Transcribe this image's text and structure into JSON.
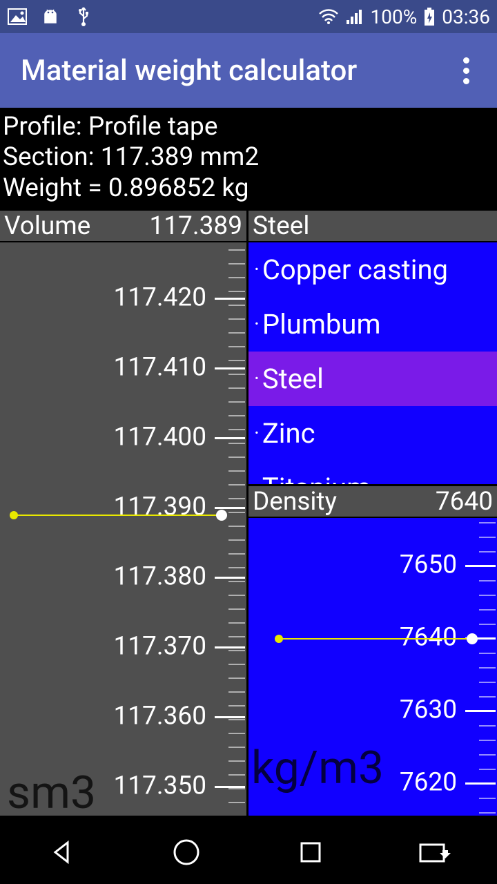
{
  "status": {
    "battery": "100%",
    "time": "03:36"
  },
  "appbar": {
    "title": "Material weight calculator"
  },
  "info": {
    "profile_label": "Profile:",
    "profile_value": "Profile tape",
    "section_label": "Section:",
    "section_value": "117.389 mm2",
    "weight_label": "Weight =",
    "weight_value": "0.896852 kg"
  },
  "volume": {
    "label": "Volume",
    "value": "117.389",
    "unit": "sm3",
    "ticks": [
      "117.420",
      "117.410",
      "117.400",
      "117.390",
      "117.380",
      "117.370",
      "117.360",
      "117.350"
    ]
  },
  "material": {
    "selected_header": "Steel",
    "items": [
      "Copper casting",
      "Plumbum",
      "Steel",
      "Zinc",
      "Titanium"
    ],
    "selected_index": 2
  },
  "density": {
    "label": "Density",
    "value": "7640",
    "unit": "kg/m3",
    "ticks": [
      "7650",
      "7640",
      "7630",
      "7620"
    ]
  }
}
